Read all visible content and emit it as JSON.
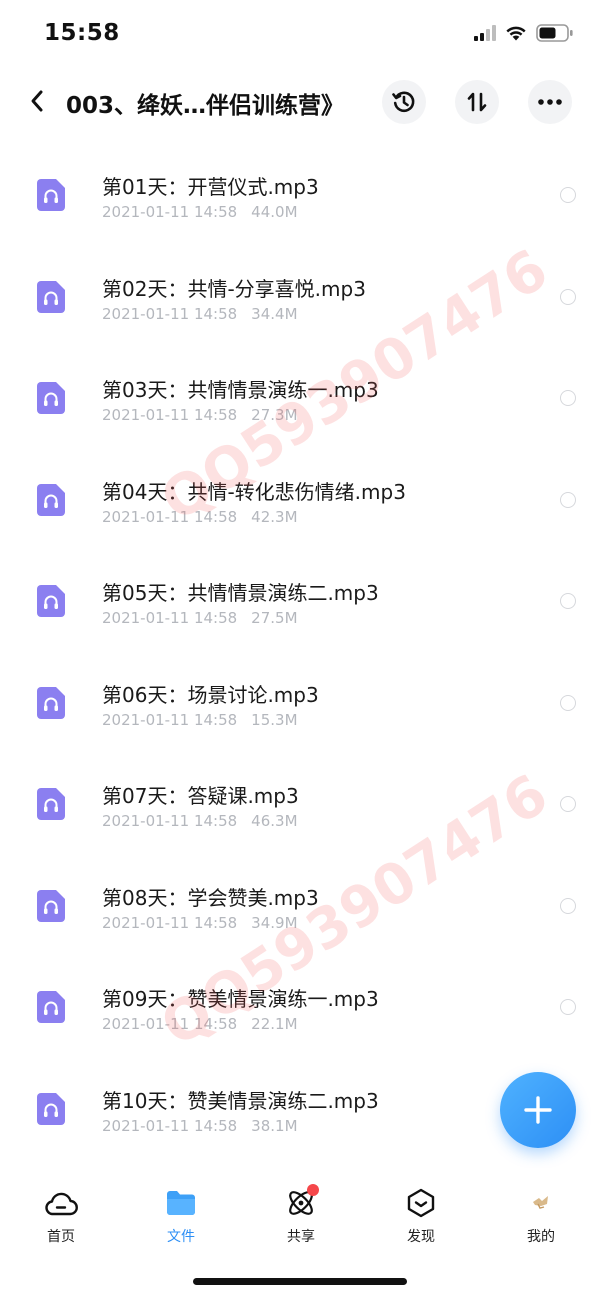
{
  "status_bar": {
    "time": "15:58"
  },
  "header": {
    "title": "003、绛妖…伴侣训练营》"
  },
  "watermark_text": "QQ593907476",
  "files": [
    {
      "name": "第01天：开营仪式.mp3",
      "date": "2021-01-11 14:58",
      "size": "44.0M"
    },
    {
      "name": "第02天：共情-分享喜悦.mp3",
      "date": "2021-01-11 14:58",
      "size": "34.4M"
    },
    {
      "name": "第03天：共情情景演练一.mp3",
      "date": "2021-01-11 14:58",
      "size": "27.3M"
    },
    {
      "name": "第04天：共情-转化悲伤情绪.mp3",
      "date": "2021-01-11 14:58",
      "size": "42.3M"
    },
    {
      "name": "第05天：共情情景演练二.mp3",
      "date": "2021-01-11 14:58",
      "size": "27.5M"
    },
    {
      "name": "第06天：场景讨论.mp3",
      "date": "2021-01-11 14:58",
      "size": "15.3M"
    },
    {
      "name": "第07天：答疑课.mp3",
      "date": "2021-01-11 14:58",
      "size": "46.3M"
    },
    {
      "name": "第08天：学会赞美.mp3",
      "date": "2021-01-11 14:58",
      "size": "34.9M"
    },
    {
      "name": "第09天：赞美情景演练一.mp3",
      "date": "2021-01-11 14:58",
      "size": "22.1M"
    },
    {
      "name": "第10天：赞美情景演练二.mp3",
      "date": "2021-01-11 14:58",
      "size": "38.1M"
    }
  ],
  "tabs": [
    {
      "label": "首页",
      "icon": "cloud-icon"
    },
    {
      "label": "文件",
      "icon": "folder-icon",
      "active": true
    },
    {
      "label": "共享",
      "icon": "share-orbit-icon",
      "badge": true
    },
    {
      "label": "发现",
      "icon": "discover-icon"
    },
    {
      "label": "我的",
      "icon": "avatar-icon"
    }
  ],
  "colors": {
    "accent": "#2d8ff5",
    "file_icon": "#8b7ff0",
    "badge": "#f5474a",
    "watermark": "#f45a5a"
  }
}
